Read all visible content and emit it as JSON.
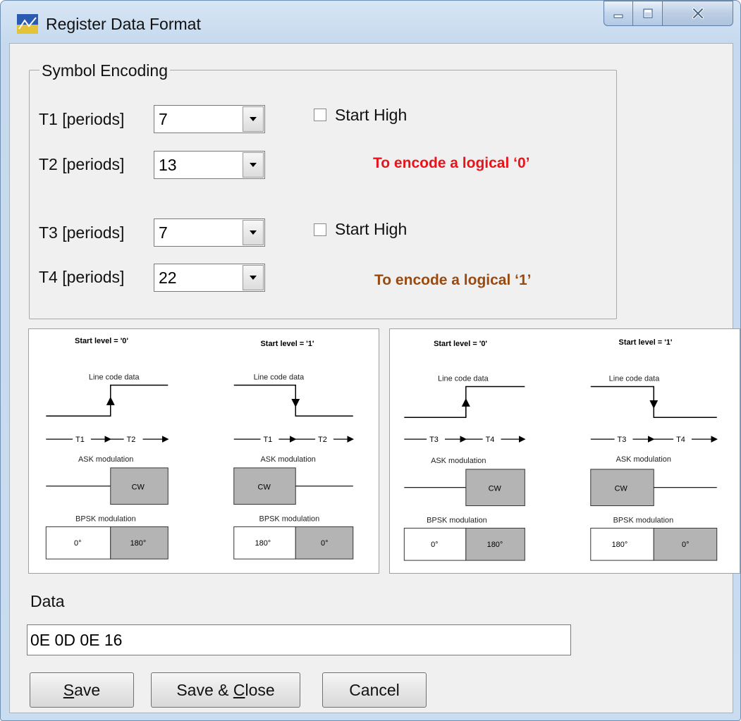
{
  "window": {
    "title": "Register Data Format",
    "icon": "mlx-app-icon"
  },
  "caption_buttons": {
    "minimize": "minimize-icon",
    "maximize": "maximize-icon",
    "close": "close-icon"
  },
  "symbol_encoding": {
    "title": "Symbol Encoding",
    "t1": {
      "label": "T1 [periods]",
      "value": "7"
    },
    "t2": {
      "label": "T2 [periods]",
      "value": "13"
    },
    "t3": {
      "label": "T3 [periods]",
      "value": "7"
    },
    "t4": {
      "label": "T4 [periods]",
      "value": "22"
    },
    "start_high_1": {
      "label": "Start High",
      "checked": false
    },
    "start_high_2": {
      "label": "Start High",
      "checked": false
    },
    "note_zero": {
      "text": "To encode a logical ‘0’",
      "color": "#e8141c"
    },
    "note_one": {
      "text": "To encode a logical ‘1’",
      "color": "#9b4a0f"
    }
  },
  "diagrams": [
    {
      "start_0": "Start level = '0'",
      "start_1": "Start level = '1'",
      "line_code": "Line code data",
      "ta": "T1",
      "tb": "T2",
      "ask": "ASK modulation",
      "cw": "CW",
      "bpsk": "BPSK modulation",
      "deg0": "0°",
      "deg180": "180°"
    },
    {
      "start_0": "Start level = '0'",
      "start_1": "Start level = '1'",
      "line_code": "Line code data",
      "ta": "T3",
      "tb": "T4",
      "ask": "ASK modulation",
      "cw": "CW",
      "bpsk": "BPSK modulation",
      "deg0": "0°",
      "deg180": "180°"
    }
  ],
  "data": {
    "label": "Data",
    "value": "0E 0D 0E 16"
  },
  "buttons": {
    "save": {
      "pre": "",
      "mnemonic": "S",
      "post": "ave"
    },
    "save_close": {
      "pre": "Save & ",
      "mnemonic": "C",
      "post": "lose"
    },
    "cancel": {
      "label": "Cancel"
    }
  },
  "colors": {
    "note_zero": "#e8141c",
    "note_one": "#9b4a0f",
    "cw_fill": "#b4b4b4"
  }
}
